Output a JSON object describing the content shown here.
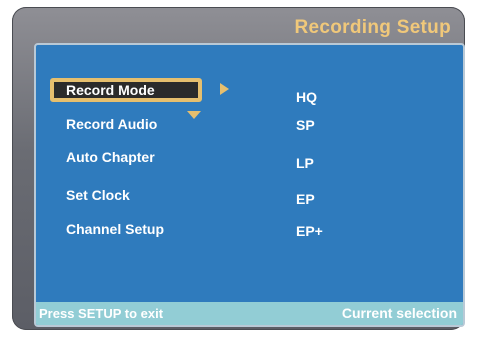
{
  "header": {
    "title": "Recording Setup"
  },
  "menu": {
    "items": [
      {
        "label": "Record Mode",
        "selected": true
      },
      {
        "label": "Record Audio",
        "selected": false
      },
      {
        "label": "Auto Chapter",
        "selected": false
      },
      {
        "label": "Set Clock",
        "selected": false
      },
      {
        "label": "Channel Setup",
        "selected": false
      }
    ]
  },
  "options": {
    "items": [
      "HQ",
      "SP",
      "LP",
      "EP",
      "EP+"
    ]
  },
  "footer": {
    "hint": "Press SETUP to exit",
    "status": "Current selection"
  },
  "colors": {
    "panel": "#2f7bbd",
    "highlight": "#e6bf6e",
    "title": "#f0c87a",
    "footer": "#92cdd5"
  },
  "icons": {
    "selection_right": "triangle-right-icon",
    "selection_down": "triangle-down-icon"
  }
}
